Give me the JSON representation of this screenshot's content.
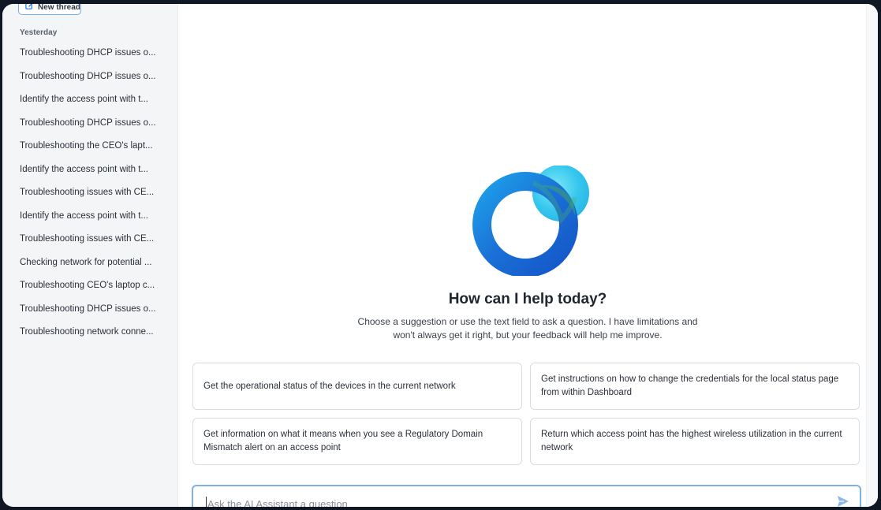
{
  "sidebar": {
    "new_thread_label": "New thread",
    "section_label": "Yesterday",
    "threads": [
      "Troubleshooting DHCP issues o...",
      "Troubleshooting DHCP issues o...",
      "Identify the access point with t...",
      "Troubleshooting DHCP issues o...",
      "Troubleshooting the CEO's lapt...",
      "Identify the access point with t...",
      "Troubleshooting issues with CE...",
      "Identify the access point with t...",
      "Troubleshooting issues with CE...",
      "Checking network for potential ...",
      "Troubleshooting CEO's laptop c...",
      "Troubleshooting DHCP issues o...",
      "Troubleshooting network conne..."
    ]
  },
  "main": {
    "headline": "How can I help today?",
    "subtext": "Choose a suggestion or use the text field to ask a question. I have limitations and won't always get it right, but your feedback will help me improve.",
    "suggestions": [
      "Get the operational status of the devices in the current network",
      "Get instructions on how to change the credentials for the local status page from within Dashboard",
      "Get information on what it means when you see a Regulatory Domain Mismatch alert on an access point",
      "Return which access point has the highest wireless utilization in the current network"
    ],
    "input": {
      "placeholder": "Ask the AI Assistant a question",
      "value": ""
    }
  },
  "colors": {
    "accent_blue": "#1a73e8",
    "logo_cyan": "#4fd3f2",
    "logo_green": "#3fa36b",
    "input_border": "#7fb0e8"
  },
  "icons": {
    "new_thread": "edit-icon",
    "send": "send-icon",
    "logo": "ai-assistant-logo"
  }
}
